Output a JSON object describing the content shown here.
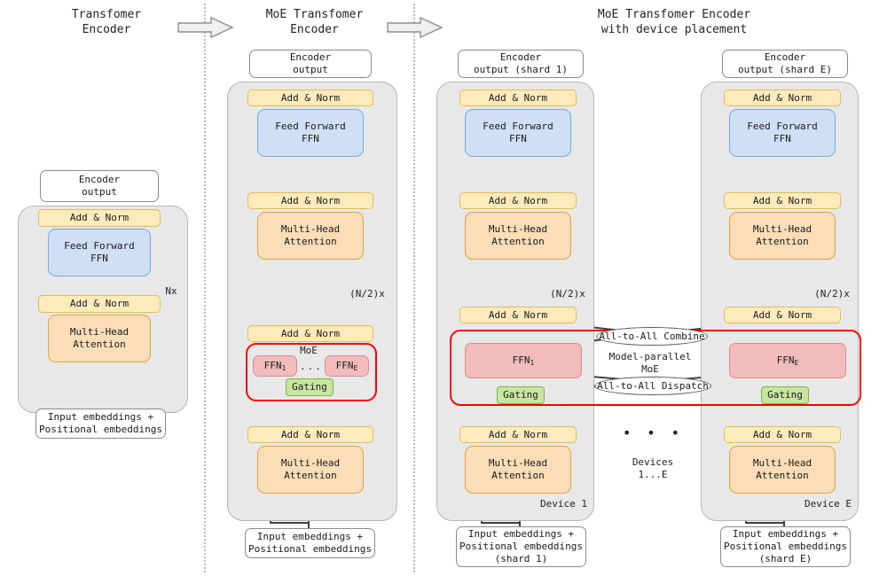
{
  "figure": {
    "columns": [
      {
        "id": "plain",
        "title": "Transfomer\nEncoder"
      },
      {
        "id": "moe",
        "title": "MoE Transfomer\nEncoder"
      },
      {
        "id": "device",
        "title": "MoE Transfomer Encoder\nwith device placement"
      }
    ],
    "arrows": [
      {
        "name": "arrow-1-to-2",
        "glyph": "block-right-arrow"
      },
      {
        "name": "arrow-2-to-3",
        "glyph": "block-right-arrow"
      }
    ]
  },
  "labels": {
    "add_norm": "Add & Norm",
    "feed_forward": "Feed Forward\nFFN",
    "multi_head": "Multi-Head\nAttention",
    "encoder_output": "Encoder\noutput",
    "encoder_output_shard1": "Encoder\noutput (shard 1)",
    "encoder_output_shardE": "Encoder\noutput (shard E)",
    "input_embeddings": "Input embeddings +\nPositional embeddings",
    "input_embeddings_shard1": "Input embeddings +\nPositional embeddings\n(shard 1)",
    "input_embeddings_shardE": "Input embeddings +\nPositional embeddings\n(shard E)",
    "moe": "MoE",
    "ffn_1": "FFN",
    "ffn_1_sub": "1",
    "ffn_E": "FFN",
    "ffn_E_sub": "E",
    "ellipsis": "...",
    "gating": "Gating",
    "repeat_nx": "Nx",
    "repeat_half_nx": "(N/2)x",
    "model_parallel_moe": "Model-parallel\nMoE",
    "all_to_all_combine": "All-to-All Combine",
    "all_to_all_dispatch": "All-to-All Dispatch",
    "device_1": "Device 1",
    "device_E": "Device E",
    "devices_range": "Devices\n1...E",
    "device_dots": "•  •  •"
  },
  "colors": {
    "add_norm_fill": "#fdebbb",
    "add_norm_stroke": "#e3bc52",
    "ffn_fill": "#cfdff5",
    "ffn_stroke": "#7ba7db",
    "attention_fill": "#fbddb7",
    "attention_stroke": "#e0a240",
    "expert_fill": "#f2bcbc",
    "expert_stroke": "#d98c8c",
    "gating_fill": "#c7e5a0",
    "gating_stroke": "#7fb344",
    "container_fill": "#e8e8e8",
    "container_stroke": "#b5b5b5",
    "moe_outline": "#ff0000",
    "wire": "#404040",
    "divider": "#b9b9b9"
  }
}
